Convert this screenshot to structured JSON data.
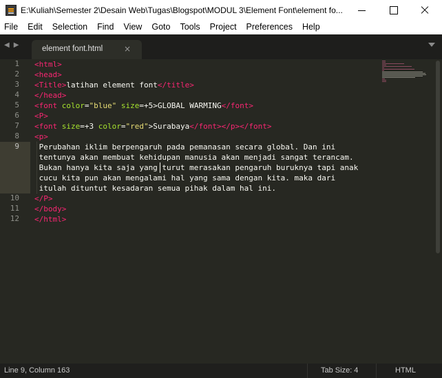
{
  "window": {
    "title": "E:\\Kuliah\\Semester 2\\Desain Web\\Tugas\\Blogspot\\MODUL 3\\Element Font\\element fo...",
    "icon": "sublime-text-icon"
  },
  "menu": [
    "File",
    "Edit",
    "Selection",
    "Find",
    "View",
    "Goto",
    "Tools",
    "Project",
    "Preferences",
    "Help"
  ],
  "tabs": [
    {
      "label": "element font.html",
      "close": "×",
      "active": true
    }
  ],
  "editor": {
    "line_numbers": [
      "1",
      "2",
      "3",
      "4",
      "5",
      "6",
      "7",
      "8",
      "9",
      "",
      "",
      "",
      "",
      "10",
      "11",
      "12"
    ],
    "active_line": "9",
    "lines": [
      [
        [
          "tg",
          "<"
        ],
        [
          "tg",
          "html"
        ],
        [
          "tg",
          ">"
        ]
      ],
      [
        [
          "tg",
          "<"
        ],
        [
          "tg",
          "head"
        ],
        [
          "tg",
          ">"
        ]
      ],
      [
        [
          "tg",
          "<"
        ],
        [
          "tg",
          "Title"
        ],
        [
          "tg",
          ">"
        ],
        [
          "tx",
          "latihan element font"
        ],
        [
          "tg",
          "</"
        ],
        [
          "tg",
          "title"
        ],
        [
          "tg",
          ">"
        ]
      ],
      [
        [
          "tg",
          "</"
        ],
        [
          "tg",
          "head"
        ],
        [
          "tg",
          ">"
        ]
      ],
      [
        [
          "tg",
          "<"
        ],
        [
          "tg",
          "font"
        ],
        [
          "pu",
          " "
        ],
        [
          "at",
          "color"
        ],
        [
          "pu",
          "="
        ],
        [
          "st",
          "\"blue\""
        ],
        [
          "pu",
          " "
        ],
        [
          "at",
          "size"
        ],
        [
          "pu",
          "=+5>"
        ],
        [
          "tx",
          "GLOBAL WARMING"
        ],
        [
          "tg",
          "</"
        ],
        [
          "tg",
          "font"
        ],
        [
          "tg",
          ">"
        ]
      ],
      [
        [
          "tg",
          "<"
        ],
        [
          "tg",
          "P"
        ],
        [
          "tg",
          ">"
        ]
      ],
      [
        [
          "tg",
          "<"
        ],
        [
          "tg",
          "font"
        ],
        [
          "pu",
          " "
        ],
        [
          "at",
          "size"
        ],
        [
          "pu",
          "=+3 "
        ],
        [
          "at",
          "color"
        ],
        [
          "pu",
          "="
        ],
        [
          "st",
          "\"red\""
        ],
        [
          "pu",
          ">"
        ],
        [
          "tx",
          "Surabaya"
        ],
        [
          "tg",
          "</"
        ],
        [
          "tg",
          "font"
        ],
        [
          "tg",
          "></"
        ],
        [
          "tg",
          "p"
        ],
        [
          "tg",
          "></"
        ],
        [
          "tg",
          "font"
        ],
        [
          "tg",
          ">"
        ]
      ],
      [
        [
          "tg",
          "<"
        ],
        [
          "tg",
          "p"
        ],
        [
          "tg",
          ">"
        ]
      ],
      [
        [
          "tx",
          " Perubahan iklim berpengaruh pada pemanasan secara global. Dan ini"
        ]
      ],
      [
        [
          "tx",
          " tentunya akan membuat kehidupan manusia akan menjadi sangat terancam."
        ]
      ],
      [
        [
          "tx",
          " Bukan hanya kita saja yang turut merasakan pengaruh buruknya tapi anak"
        ]
      ],
      [
        [
          "tx",
          " cucu kita pun akan mengalami hal yang sama dengan kita. maka dari"
        ]
      ],
      [
        [
          "tx",
          " itulah dituntut kesadaran semua pihak dalam hal ini."
        ]
      ],
      [
        [
          "tg",
          "</"
        ],
        [
          "tg",
          "P"
        ],
        [
          "tg",
          ">"
        ]
      ],
      [
        [
          "tg",
          "</"
        ],
        [
          "tg",
          "body"
        ],
        [
          "tg",
          ">"
        ]
      ],
      [
        [
          "tg",
          "</"
        ],
        [
          "tg",
          "html"
        ],
        [
          "tg",
          ">"
        ]
      ]
    ]
  },
  "status": {
    "position": "Line 9, Column 163",
    "tab_size": "Tab Size: 4",
    "syntax": "HTML"
  },
  "colors": {
    "editor_bg": "#272822",
    "tag": "#f92672",
    "attribute": "#a6e22e",
    "string": "#e6db74",
    "text": "#f8f8f2",
    "line_number": "#8f908a"
  }
}
